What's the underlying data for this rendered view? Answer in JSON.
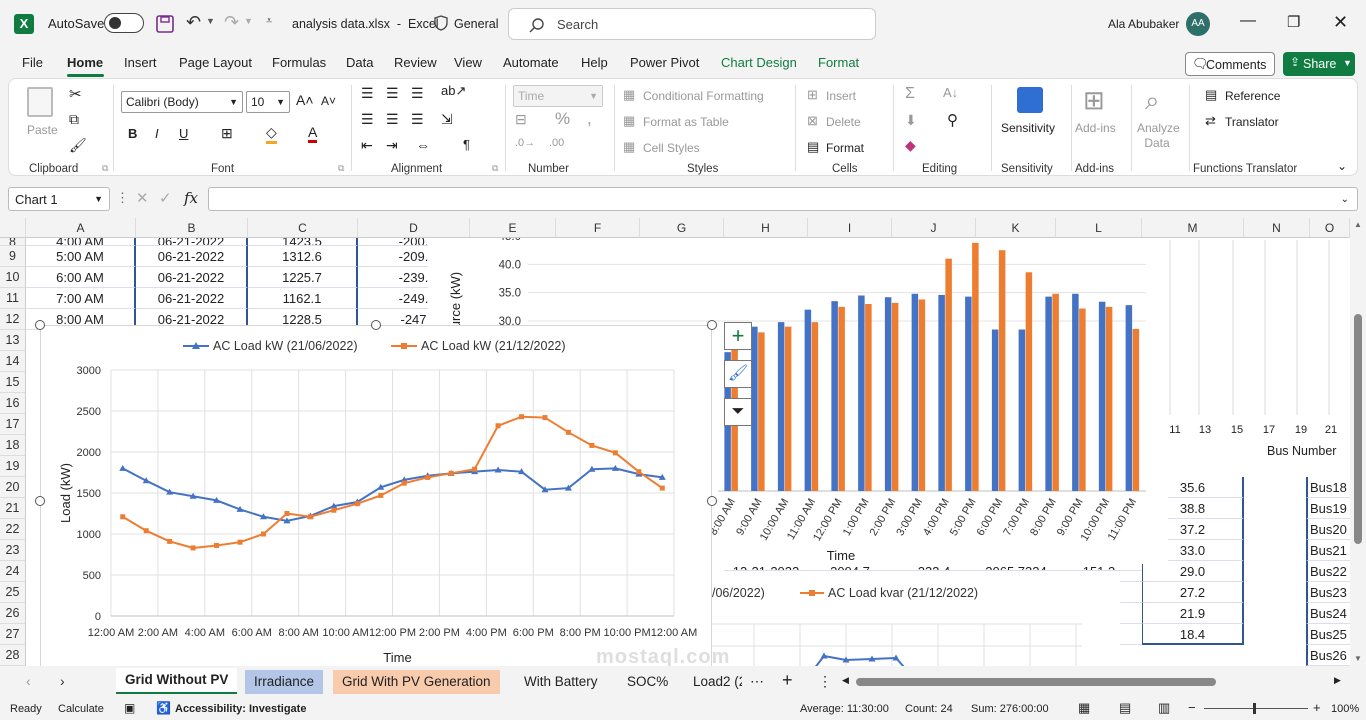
{
  "titlebar": {
    "autosave_label": "AutoSave",
    "filename": "analysis data.xlsx  -  Excel",
    "sensitivity": "General",
    "search_placeholder": "Search",
    "user_name": "Ala Abubaker",
    "user_initials": "AA"
  },
  "tabs": [
    "File",
    "Home",
    "Insert",
    "Page Layout",
    "Formulas",
    "Data",
    "Review",
    "View",
    "Automate",
    "Help",
    "Power Pivot",
    "Chart Design",
    "Format"
  ],
  "ribbon": {
    "paste": "Paste",
    "font_name": "Calibri (Body)",
    "font_size": "10",
    "number_format": "Time",
    "cond_format": "Conditional Formatting",
    "format_table": "Format as Table",
    "cell_styles": "Cell Styles",
    "insert": "Insert",
    "delete": "Delete",
    "format": "Format",
    "sensitivity": "Sensitivity",
    "addins": "Add-ins",
    "analyze": "Analyze Data",
    "reference": "Reference",
    "translator": "Translator",
    "comments": "Comments",
    "share": "Share",
    "groups": {
      "clipboard": "Clipboard",
      "font": "Font",
      "alignment": "Alignment",
      "number": "Number",
      "styles": "Styles",
      "cells": "Cells",
      "editing": "Editing",
      "sensitivity": "Sensitivity",
      "addins": "Add-ins",
      "functions": "Functions Translator"
    }
  },
  "formula_bar": {
    "name_box": "Chart 1",
    "fx": "fx"
  },
  "columns": [
    "A",
    "B",
    "C",
    "D",
    "E",
    "F",
    "G",
    "H",
    "I",
    "J",
    "K",
    "L",
    "M",
    "N",
    "O"
  ],
  "rows": [
    "8",
    "9",
    "10",
    "11",
    "12",
    "13",
    "14",
    "15",
    "16",
    "17",
    "18",
    "19",
    "20",
    "21",
    "22",
    "23",
    "24",
    "25",
    "26",
    "27",
    "28"
  ],
  "table_rows": [
    {
      "a": "4:00 AM",
      "b": "06-21-2022",
      "c": "1423.5",
      "d": "-200."
    },
    {
      "a": "5:00 AM",
      "b": "06-21-2022",
      "c": "1312.6",
      "d": "-209."
    },
    {
      "a": "6:00 AM",
      "b": "06-21-2022",
      "c": "1225.7",
      "d": "-239."
    },
    {
      "a": "7:00 AM",
      "b": "06-21-2022",
      "c": "1162.1",
      "d": "-249."
    },
    {
      "a": "8:00 AM",
      "b": "06-21-2022",
      "c": "1228.5",
      "d": "-247"
    }
  ],
  "row23": {
    "h": "12-21-2022",
    "i": "2094.7",
    "j": "232.4",
    "k": "2065.7324",
    "l": "151.3"
  },
  "m_values": [
    "35.6",
    "38.8",
    "37.2",
    "33.0",
    "29.0",
    "27.2",
    "21.9",
    "18.4"
  ],
  "o_values": [
    "Bus18",
    "Bus19",
    "Bus20",
    "Bus21",
    "Bus22",
    "Bus23",
    "Bus24",
    "Bus25",
    "Bus26"
  ],
  "bus_axis": {
    "ticks": [
      "11",
      "13",
      "15",
      "17",
      "19",
      "21"
    ],
    "label": "Bus Number"
  },
  "chart_data": [
    {
      "type": "line",
      "title": "",
      "xlabel": "Time",
      "ylabel": "Load (kW)",
      "ylim": [
        0,
        3000
      ],
      "y_ticks": [
        "0",
        "500",
        "1000",
        "1500",
        "2000",
        "2500",
        "3000"
      ],
      "x_ticks": [
        "12:00 AM",
        "2:00 AM",
        "4:00 AM",
        "6:00 AM",
        "8:00 AM",
        "10:00 AM",
        "12:00 PM",
        "2:00 PM",
        "4:00 PM",
        "6:00 PM",
        "8:00 PM",
        "10:00 PM",
        "12:00 AM"
      ],
      "series": [
        {
          "name": "AC Load kW (21/06/2022)",
          "color": "#4472c4",
          "values": [
            1800,
            1650,
            1510,
            1460,
            1410,
            1300,
            1210,
            1160,
            1220,
            1340,
            1390,
            1570,
            1660,
            1710,
            1740,
            1760,
            1780,
            1760,
            1540,
            1560,
            1790,
            1800,
            1730,
            1690
          ]
        },
        {
          "name": "AC Load kW (21/12/2022)",
          "color": "#ed7d31",
          "values": [
            1210,
            1040,
            910,
            830,
            860,
            900,
            1000,
            1250,
            1210,
            1290,
            1370,
            1470,
            1620,
            1690,
            1740,
            1790,
            2320,
            2430,
            2420,
            2240,
            2080,
            1990,
            1760,
            1560
          ]
        }
      ]
    },
    {
      "type": "bar",
      "xlabel": "Time",
      "ylabel": "Source (kW)",
      "ylim": [
        0,
        45
      ],
      "y_ticks": [
        "30.0",
        "35.0",
        "40.0",
        "45.0"
      ],
      "categories": [
        "8:00 AM",
        "9:00 AM",
        "10:00 AM",
        "11:00 AM",
        "12:00 PM",
        "1:00 PM",
        "2:00 PM",
        "3:00 PM",
        "4:00 PM",
        "5:00 PM",
        "6:00 PM",
        "7:00 PM",
        "8:00 PM",
        "9:00 PM",
        "10:00 PM",
        "11:00 PM"
      ],
      "series": [
        {
          "color": "#4472c4",
          "values": [
            24.5,
            29.0,
            29.8,
            32.0,
            33.5,
            34.5,
            34.2,
            34.8,
            34.6,
            34.3,
            28.5,
            28.5,
            34.3,
            34.8,
            33.4,
            32.8
          ]
        },
        {
          "color": "#ed7d31",
          "values": [
            25.5,
            28.0,
            29.0,
            29.8,
            32.5,
            33.0,
            33.2,
            33.8,
            41.0,
            43.8,
            42.5,
            38.6,
            34.8,
            32.2,
            32.5,
            28.6
          ]
        }
      ]
    },
    {
      "type": "line",
      "legend": [
        "/06/2022)",
        "AC Load kvar (21/12/2022)"
      ]
    }
  ],
  "sheet_tabs": [
    "Grid Without PV",
    "Irradiance",
    "Grid With PV Generation",
    "With Battery",
    "SOC%",
    "Load2 (2"
  ],
  "status": {
    "ready": "Ready",
    "calculate": "Calculate",
    "accessibility": "Accessibility: Investigate",
    "average": "Average: 11:30:00",
    "count": "Count: 24",
    "sum": "Sum: 276:00:00",
    "zoom": "100%"
  },
  "watermark": "mostaql.com"
}
